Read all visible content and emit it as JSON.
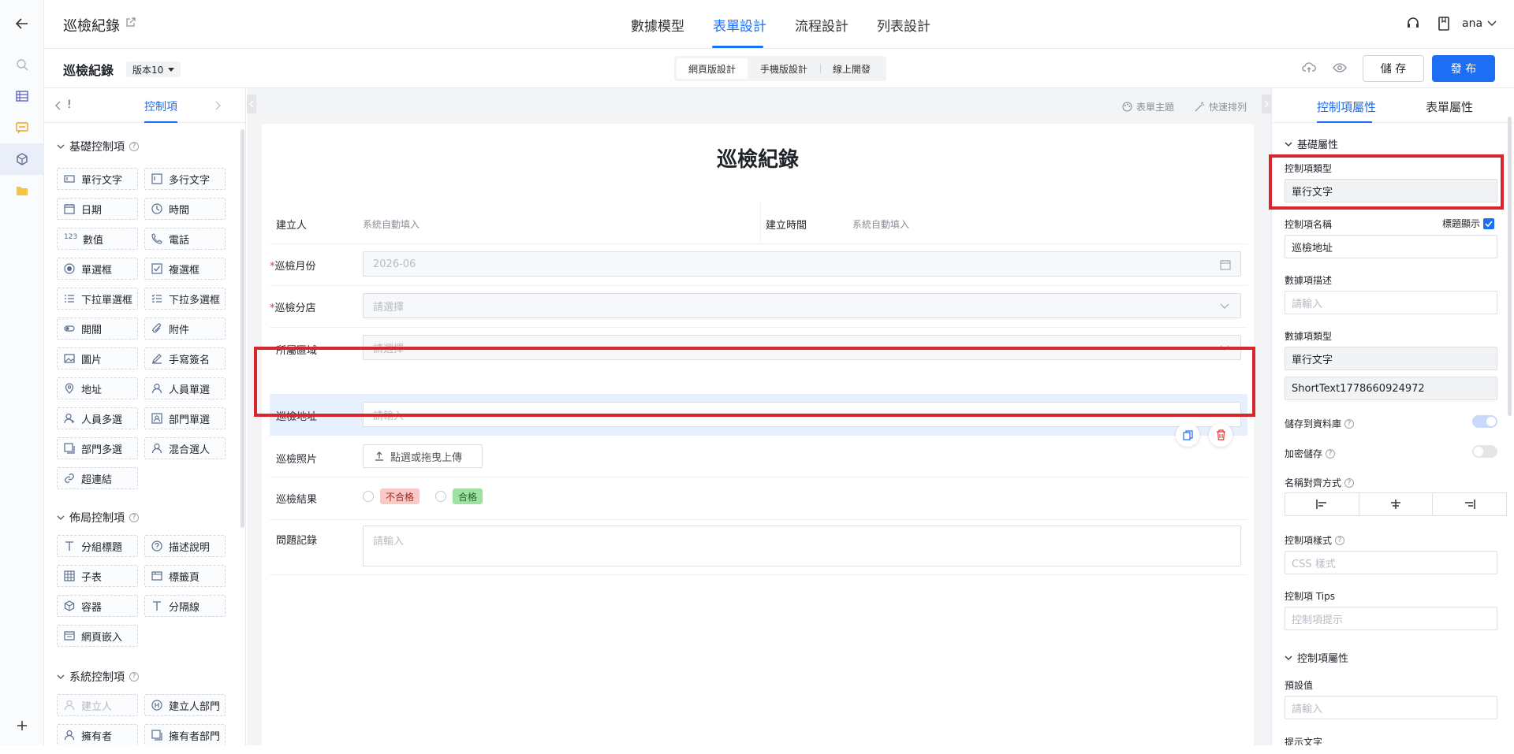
{
  "header": {
    "app_title": "巡檢紀錄",
    "tabs": [
      {
        "label": "數據模型",
        "active": false
      },
      {
        "label": "表單設計",
        "active": true
      },
      {
        "label": "流程設計",
        "active": false
      },
      {
        "label": "列表設計",
        "active": false
      }
    ],
    "user": "ana"
  },
  "toolbar": {
    "form_name": "巡檢紀錄",
    "version": "版本10",
    "modes": [
      "網頁版設計",
      "手機版設計",
      "線上開發"
    ],
    "active_mode": "網頁版設計",
    "save_label": "儲 存",
    "publish_label": "發 布"
  },
  "left_panel": {
    "back_tab": "!",
    "active_tab": "控制項",
    "groups": [
      {
        "title": "基礎控制項",
        "items": [
          {
            "label": "單行文字",
            "icon": "single-line-text-icon"
          },
          {
            "label": "多行文字",
            "icon": "multi-line-text-icon"
          },
          {
            "label": "日期",
            "icon": "calendar-icon"
          },
          {
            "label": "時間",
            "icon": "clock-icon"
          },
          {
            "label": "數值",
            "icon": "number-icon"
          },
          {
            "label": "電話",
            "icon": "phone-icon"
          },
          {
            "label": "單選框",
            "icon": "radio-icon"
          },
          {
            "label": "複選框",
            "icon": "checkbox-icon"
          },
          {
            "label": "下拉單選框",
            "icon": "dropdown-single-icon"
          },
          {
            "label": "下拉多選框",
            "icon": "dropdown-multi-icon"
          },
          {
            "label": "開關",
            "icon": "toggle-icon"
          },
          {
            "label": "附件",
            "icon": "paperclip-icon"
          },
          {
            "label": "圖片",
            "icon": "image-icon"
          },
          {
            "label": "手寫簽名",
            "icon": "pen-icon"
          },
          {
            "label": "地址",
            "icon": "location-icon"
          },
          {
            "label": "人員單選",
            "icon": "user-icon"
          },
          {
            "label": "人員多選",
            "icon": "users-icon"
          },
          {
            "label": "部門單選",
            "icon": "department-icon"
          },
          {
            "label": "部門多選",
            "icon": "departments-icon"
          },
          {
            "label": "混合選人",
            "icon": "mixed-user-icon"
          },
          {
            "label": "超連結",
            "icon": "link-icon"
          }
        ]
      },
      {
        "title": "佈局控制項",
        "items": [
          {
            "label": "分組標題",
            "icon": "heading-icon"
          },
          {
            "label": "描述說明",
            "icon": "help-circle-icon"
          },
          {
            "label": "子表",
            "icon": "table-icon"
          },
          {
            "label": "標籤頁",
            "icon": "tabs-icon"
          },
          {
            "label": "容器",
            "icon": "cube-icon"
          },
          {
            "label": "分隔線",
            "icon": "divider-icon"
          },
          {
            "label": "網頁嵌入",
            "icon": "embed-icon"
          }
        ]
      },
      {
        "title": "系統控制項",
        "items": [
          {
            "label": "建立人",
            "icon": "user-icon",
            "disabled": true
          },
          {
            "label": "建立人部門",
            "icon": "department-icon"
          },
          {
            "label": "擁有者",
            "icon": "user-icon"
          },
          {
            "label": "擁有者部門",
            "icon": "department-icon"
          }
        ]
      }
    ]
  },
  "canvas": {
    "tools": [
      "表單主題",
      "快速排列"
    ],
    "form_title": "巡檢紀錄",
    "fields": {
      "creator": {
        "label": "建立人",
        "value": "系統自動填入"
      },
      "created_time": {
        "label": "建立時間",
        "value": "系統自動填入"
      },
      "month": {
        "label": "巡檢月份",
        "required": true,
        "placeholder": "2026-06"
      },
      "branch": {
        "label": "巡檢分店",
        "required": true,
        "placeholder": "請選擇"
      },
      "region": {
        "label": "所屬區域",
        "placeholder": "請選擇"
      },
      "address": {
        "label": "巡檢地址",
        "placeholder": "請輸入"
      },
      "photo": {
        "label": "巡檢照片",
        "button": "點選或拖曳上傳"
      },
      "result": {
        "label": "巡檢結果",
        "options": [
          "不合格",
          "合格"
        ]
      },
      "issues": {
        "label": "問題記錄",
        "placeholder": "請輸入"
      }
    }
  },
  "right_panel": {
    "tabs": [
      "控制項屬性",
      "表單屬性"
    ],
    "active_tab": "控制項屬性",
    "section_basic": "基礎屬性",
    "control_type_label": "控制項類型",
    "control_type_value": "單行文字",
    "control_name_label": "控制項名稱",
    "show_title_label": "標題顯示",
    "show_title_checked": true,
    "control_name_value": "巡檢地址",
    "data_desc_label": "數據項描述",
    "data_desc_placeholder": "請輸入",
    "data_type_label": "數據項類型",
    "data_type_value": "單行文字",
    "data_field_id": "ShortText1778660924972",
    "save_db_label": "儲存到資料庫",
    "save_db_on": true,
    "encrypt_label": "加密儲存",
    "encrypt_on": false,
    "name_align_label": "名稱對齊方式",
    "style_label": "控制項樣式",
    "style_placeholder": "CSS 樣式",
    "tips_label": "控制項 Tips",
    "tips_placeholder": "控制項提示",
    "section_props": "控制項屬性",
    "default_label": "預設值",
    "default_placeholder": "請輸入",
    "prompt_label": "提示文字"
  },
  "colors": {
    "accent": "#1c6ef5",
    "highlight": "#d8262c",
    "fail_tag_bg": "#f8c9c6",
    "pass_tag_bg": "#9fe0a3"
  }
}
